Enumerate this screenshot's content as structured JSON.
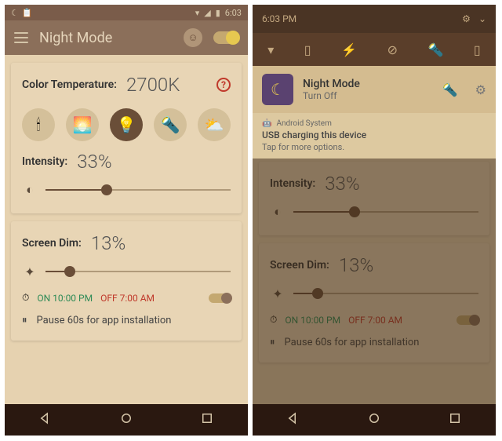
{
  "left": {
    "status_time": "6:03",
    "app_title": "Night Mode",
    "color_temp_label": "Color Temperature:",
    "color_temp_value": "2700K",
    "presets": [
      "candle",
      "sunset",
      "bulb",
      "cfl",
      "sunny"
    ],
    "intensity_label": "Intensity:",
    "intensity_value": "33%",
    "intensity_pct": 33,
    "dim_label": "Screen Dim:",
    "dim_value": "13%",
    "dim_pct": 13,
    "schedule_on_label": "ON 10:00 PM",
    "schedule_off_label": "OFF 7:00 AM",
    "pause_label": "Pause 60s for app installation"
  },
  "right": {
    "status_time": "6:03 PM",
    "notif_title": "Night Mode",
    "notif_sub": "Turn Off",
    "sys_app": "Android System",
    "sys_title": "USB charging this device",
    "sys_sub": "Tap for more options.",
    "intensity_label": "Intensity:",
    "intensity_value": "33%",
    "dim_label": "Screen Dim:",
    "dim_value": "13%",
    "schedule_on_label": "ON 10:00 PM",
    "schedule_off_label": "OFF 7:00 AM",
    "pause_label": "Pause 60s for app installation"
  }
}
